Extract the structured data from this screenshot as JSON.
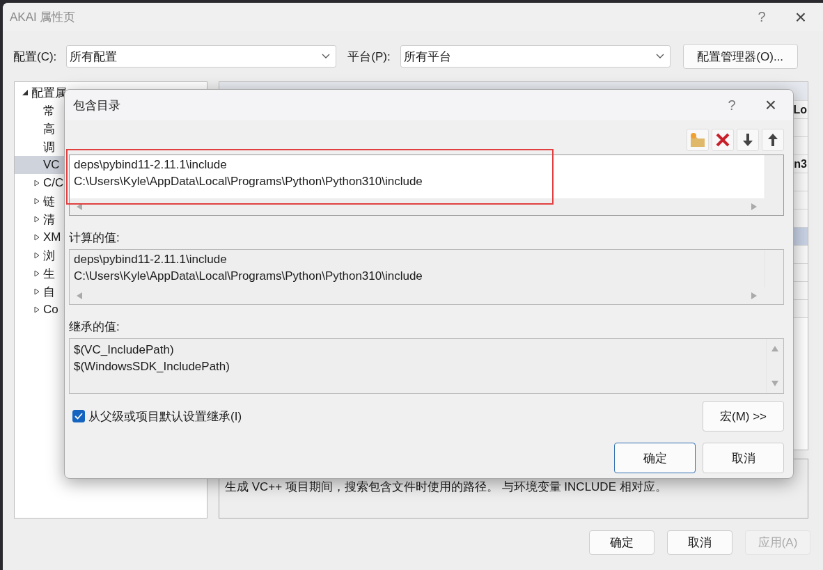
{
  "window": {
    "title": "AKAI 属性页",
    "help": "?",
    "close": "×"
  },
  "config": {
    "label": "配置(C):",
    "value": "所有配置"
  },
  "platform": {
    "label": "平台(P):",
    "value": "所有平台"
  },
  "config_manager_button": "配置管理器(O)...",
  "tree": [
    {
      "label": "配置属",
      "expanded": true,
      "selected": false,
      "children": [
        {
          "label": "常",
          "selected": false
        },
        {
          "label": "高",
          "selected": false
        },
        {
          "label": "调",
          "selected": false
        },
        {
          "label": "VC",
          "selected": true
        },
        {
          "label": "C/C",
          "expanded": false,
          "selected": false
        },
        {
          "label": "链",
          "expanded": false,
          "selected": false
        },
        {
          "label": "清",
          "expanded": false,
          "selected": false
        },
        {
          "label": "XM",
          "expanded": false,
          "selected": false
        },
        {
          "label": "浏",
          "expanded": false,
          "selected": false
        },
        {
          "label": "生",
          "expanded": false,
          "selected": false
        },
        {
          "label": "自",
          "expanded": false,
          "selected": false
        },
        {
          "label": "Co",
          "expanded": false,
          "selected": false
        }
      ]
    }
  ],
  "property_rows": [
    {
      "text": "Lo",
      "selected": false
    },
    {
      "selected": false
    },
    {
      "selected": false
    },
    {
      "text": "n3",
      "selected": false
    },
    {
      "selected": false
    },
    {
      "selected": false
    },
    {
      "selected": false
    },
    {
      "selected": true
    },
    {
      "selected": false
    },
    {
      "selected": false
    },
    {
      "selected": false
    },
    {
      "selected": false
    }
  ],
  "description": "生成 VC++ 项目期间，搜索包含文件时使用的路径。 与环境变量 INCLUDE 相对应。",
  "buttons": [
    {
      "label": "确定",
      "disabled": false
    },
    {
      "label": "取消",
      "disabled": false
    },
    {
      "label": "应用(A)",
      "disabled": true
    }
  ],
  "dialog": {
    "title": "包含目录",
    "help": "?",
    "close": "×",
    "toolbar": [
      {
        "kind": "new-folder"
      },
      {
        "kind": "delete"
      },
      {
        "kind": "move-down"
      },
      {
        "kind": "move-up"
      }
    ],
    "entries": [
      "deps\\pybind11-2.11.1\\include",
      "C:\\Users\\Kyle\\AppData\\Local\\Programs\\Python\\Python310\\include"
    ],
    "computed": {
      "label": "计算的值:",
      "lines": [
        "deps\\pybind11-2.11.1\\include",
        "C:\\Users\\Kyle\\AppData\\Local\\Programs\\Python\\Python310\\include"
      ]
    },
    "inherited": {
      "label": "继承的值:",
      "lines": [
        "$(VC_IncludePath)",
        "$(WindowsSDK_IncludePath)"
      ]
    },
    "inherit_checkbox": {
      "label": "从父级或项目默认设置继承(I)",
      "checked": true
    },
    "macros_button": "宏(M) >>",
    "ok": "确定",
    "cancel": "取消"
  }
}
